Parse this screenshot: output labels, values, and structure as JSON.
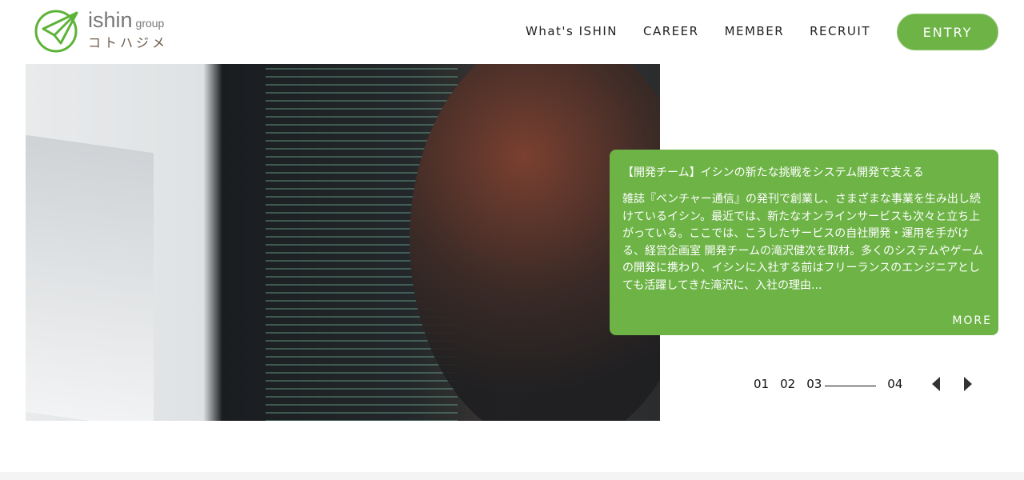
{
  "logo": {
    "word": "ishin",
    "group": "group",
    "kana": "コトハジメ"
  },
  "nav": {
    "items": [
      "What's ISHIN",
      "CAREER",
      "MEMBER",
      "RECRUIT"
    ],
    "entry": "ENTRY"
  },
  "card": {
    "title": "【開発チーム】イシンの新たな挑戦をシステム開発で支える",
    "body": "雑誌『ベンチャー通信』の発刊で創業し、さまざまな事業を生み出し続けているイシン。最近では、新たなオンラインサービスも次々と立ち上がっている。ここでは、こうしたサービスの自社開発・運用を手がける、経営企画室 開発チームの滝沢健次を取材。多くのシステムやゲームの開発に携わり、イシンに入社する前はフリーランスのエンジニアとしても活躍してきた滝沢に、入社の理由...",
    "more": "MORE"
  },
  "pager": {
    "pages": [
      "01",
      "02",
      "03",
      "04"
    ],
    "current": "03"
  },
  "colors": {
    "accent": "#6db346"
  }
}
